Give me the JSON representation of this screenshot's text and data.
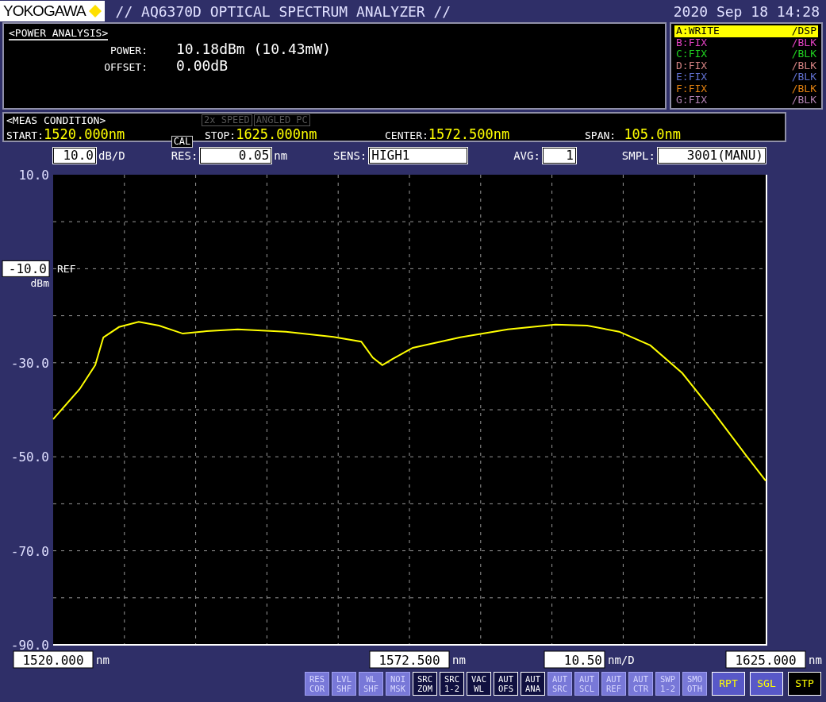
{
  "header": {
    "brand": "YOKOGAWA",
    "title": "// AQ6370D OPTICAL SPECTRUM ANALYZER //",
    "datetime": "2020 Sep 18 14:28"
  },
  "analysis": {
    "title": "<POWER ANALYSIS>",
    "rows": [
      {
        "label": "POWER:",
        "value": "10.18dBm (10.43mW)"
      },
      {
        "label": "OFFSET:",
        "value": "0.00dB"
      }
    ]
  },
  "traces": [
    {
      "label": "A:WRITE",
      "mode": "/DSP",
      "color": "#ffff00",
      "selected": true
    },
    {
      "label": "B:FIX",
      "mode": "/BLK",
      "color": "#e040c0",
      "selected": false
    },
    {
      "label": "C:FIX",
      "mode": "/BLK",
      "color": "#20d020",
      "selected": false
    },
    {
      "label": "D:FIX",
      "mode": "/BLK",
      "color": "#d08080",
      "selected": false
    },
    {
      "label": "E:FIX",
      "mode": "/BLK",
      "color": "#6070d0",
      "selected": false
    },
    {
      "label": "F:FIX",
      "mode": "/BLK",
      "color": "#e08010",
      "selected": false
    },
    {
      "label": "G:FIX",
      "mode": "/BLK",
      "color": "#b080b0",
      "selected": false
    }
  ],
  "meas_condition": {
    "title": "<MEAS CONDITION>",
    "flags": [
      {
        "label": "2x SPEED",
        "on": false
      },
      {
        "label": "ANGLED PC",
        "on": false
      }
    ],
    "items": [
      {
        "label": "START:",
        "value": "1520.000nm"
      },
      {
        "label": "STOP:",
        "value": "1625.000nm"
      },
      {
        "label": "CENTER:",
        "value": "1572.500nm"
      },
      {
        "label": "SPAN:",
        "value": " 105.0nm"
      }
    ]
  },
  "settings": {
    "scale": {
      "value": "10.0",
      "unit": "dB/D"
    },
    "cal": "CAL",
    "res": {
      "label": "RES:",
      "value": "0.05",
      "unit": "nm"
    },
    "sens": {
      "label": "SENS:",
      "value": "HIGH1"
    },
    "avg": {
      "label": "AVG:",
      "value": "1"
    },
    "smpl": {
      "label": "SMPL:",
      "value": "3001(MANU)"
    }
  },
  "chart_data": {
    "type": "line",
    "xlim": [
      1520,
      1625
    ],
    "ylim": [
      -90,
      10
    ],
    "x": [
      1520,
      1523.9,
      1526.2,
      1527.4,
      1529.7,
      1532.6,
      1535.6,
      1539.1,
      1542.6,
      1547.2,
      1554.3,
      1561.3,
      1565.4,
      1567.1,
      1568.5,
      1570.0,
      1573.0,
      1580.0,
      1587.0,
      1594.0,
      1598.7,
      1603.4,
      1608.0,
      1612.7,
      1617.4,
      1622.1,
      1625.0
    ],
    "series": [
      {
        "color": "#ffff00",
        "values": [
          -42.0,
          -35.6,
          -30.5,
          -24.6,
          -22.4,
          -21.3,
          -22.1,
          -23.8,
          -23.3,
          -22.9,
          -23.4,
          -24.5,
          -25.5,
          -28.9,
          -30.5,
          -29.2,
          -26.8,
          -24.6,
          -22.9,
          -21.9,
          -22.1,
          -23.4,
          -26.3,
          -32.2,
          -40.7,
          -49.7,
          -55.1
        ]
      }
    ],
    "yticks": [
      {
        "value": 10,
        "label": "10.0"
      },
      {
        "value": -10,
        "label": "-10.0"
      },
      {
        "value": -30,
        "label": "-30.0"
      },
      {
        "value": -50,
        "label": "-50.0"
      },
      {
        "value": -70,
        "label": "-70.0"
      },
      {
        "value": -90,
        "label": "-90.0"
      }
    ],
    "xticks": [
      {
        "value": 1520,
        "label": "1520.000"
      },
      {
        "value": 1572.5,
        "label": "1572.500"
      },
      {
        "value": 1625,
        "label": "1625.000"
      }
    ],
    "grid": true
  },
  "plot_labels": {
    "ref": "REF",
    "ref_unit": "dBm",
    "x_units": [
      "nm",
      "nm",
      "nm"
    ]
  },
  "x_span": {
    "value": "10.50",
    "unit": "nm/D"
  },
  "softkeys": [
    {
      "label": "RES COR",
      "kind": "func",
      "disabled": true
    },
    {
      "label": "LVL SHF",
      "kind": "func",
      "disabled": true
    },
    {
      "label": "WL SHF",
      "kind": "func",
      "disabled": true
    },
    {
      "label": "NOI MSK",
      "kind": "func",
      "disabled": true
    },
    {
      "label": "SRC ZOM",
      "kind": "func",
      "disabled": false
    },
    {
      "label": "SRC 1-2",
      "kind": "func",
      "disabled": false
    },
    {
      "label": "VAC WL",
      "kind": "func",
      "disabled": false
    },
    {
      "label": "AUT OFS",
      "kind": "func",
      "disabled": false
    },
    {
      "label": "AUT ANA",
      "kind": "func",
      "disabled": false
    },
    {
      "label": "AUT SRC",
      "kind": "func",
      "disabled": true
    },
    {
      "label": "AUT SCL",
      "kind": "func",
      "disabled": true
    },
    {
      "label": "AUT REF",
      "kind": "func",
      "disabled": true
    },
    {
      "label": "AUT CTR",
      "kind": "func",
      "disabled": true
    },
    {
      "label": "SWP 1-2",
      "kind": "func",
      "disabled": true
    },
    {
      "label": "SMO OTH",
      "kind": "func",
      "disabled": true
    },
    {
      "label": "RPT",
      "kind": "sweep",
      "selected": false
    },
    {
      "label": "SGL",
      "kind": "sweep",
      "selected": false
    },
    {
      "label": "STP",
      "kind": "sweep",
      "selected": true
    }
  ]
}
